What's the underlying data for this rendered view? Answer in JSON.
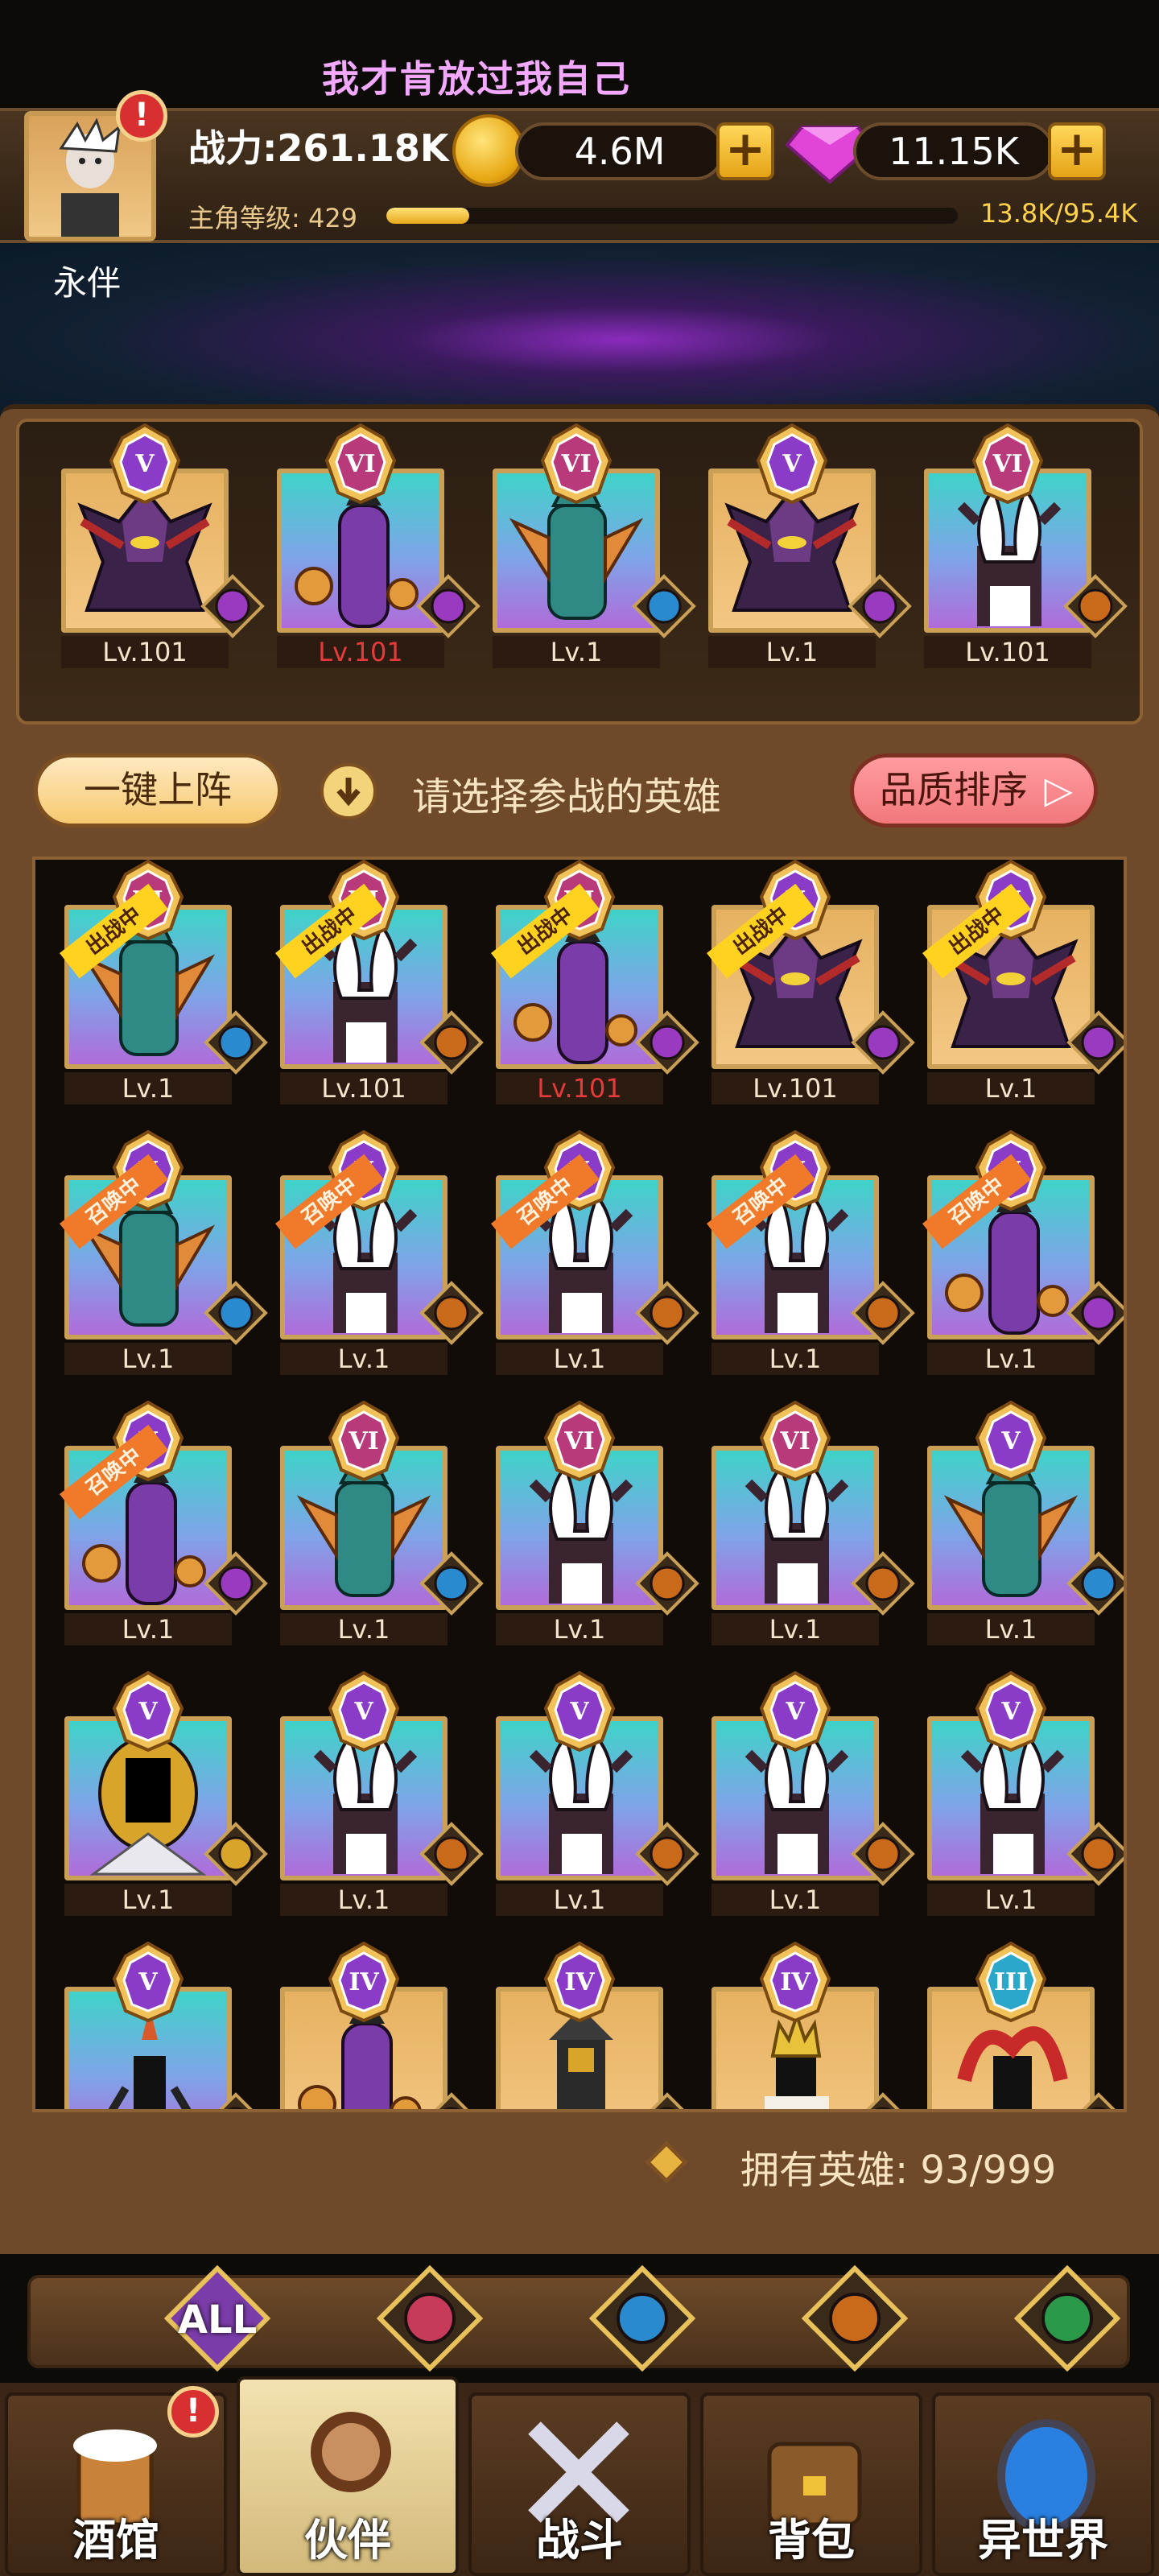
{
  "header": {
    "title": "我才肯放过我自己",
    "power": "战力:261.18K",
    "gold": "4.6M",
    "gems": "11.15K",
    "level_label": "主角等级: 429",
    "xp_text": "13.8K/95.4K",
    "xp_fraction": 0.145,
    "partner_name": "永伴"
  },
  "lineup": [
    {
      "tier": "V",
      "bg": "gold",
      "hero": "demon",
      "faction": "demon",
      "level": "Lv.101",
      "red": false
    },
    {
      "tier": "VI",
      "bg": "teal",
      "hero": "purple",
      "faction": "demon",
      "level": "Lv.101",
      "red": true
    },
    {
      "tier": "VI",
      "bg": "teal",
      "hero": "fish",
      "faction": "water",
      "level": "Lv.1",
      "red": false
    },
    {
      "tier": "V",
      "bg": "gold",
      "hero": "demon",
      "faction": "demon",
      "level": "Lv.1",
      "red": false
    },
    {
      "tier": "VI",
      "bg": "teal",
      "hero": "beast",
      "faction": "beast",
      "level": "Lv.101",
      "red": false
    }
  ],
  "controls": {
    "one_key": "一键上阵",
    "hint": "请选择参战的英雄",
    "sort": "品质排序"
  },
  "roster": [
    {
      "tier": "VI",
      "bg": "teal",
      "hero": "fish",
      "faction": "water",
      "level": "Lv.1",
      "tag": "出战中",
      "tagcolor": "y"
    },
    {
      "tier": "VI",
      "bg": "teal",
      "hero": "beast",
      "faction": "beast",
      "level": "Lv.101",
      "tag": "出战中",
      "tagcolor": "y"
    },
    {
      "tier": "VI",
      "bg": "teal",
      "hero": "purple",
      "faction": "demon",
      "level": "Lv.101",
      "tag": "出战中",
      "tagcolor": "y",
      "red": true
    },
    {
      "tier": "V",
      "bg": "gold",
      "hero": "demon",
      "faction": "demon",
      "level": "Lv.101",
      "tag": "出战中",
      "tagcolor": "y"
    },
    {
      "tier": "V",
      "bg": "gold",
      "hero": "demon",
      "faction": "demon",
      "level": "Lv.1",
      "tag": "出战中",
      "tagcolor": "y"
    },
    {
      "tier": "V",
      "bg": "teal",
      "hero": "fish",
      "faction": "water",
      "level": "Lv.1",
      "tag": "召唤中",
      "tagcolor": "o"
    },
    {
      "tier": "V",
      "bg": "teal",
      "hero": "beast",
      "faction": "beast",
      "level": "Lv.1",
      "tag": "召唤中",
      "tagcolor": "o"
    },
    {
      "tier": "V",
      "bg": "teal",
      "hero": "beast",
      "faction": "beast",
      "level": "Lv.1",
      "tag": "召唤中",
      "tagcolor": "o"
    },
    {
      "tier": "V",
      "bg": "teal",
      "hero": "beast",
      "faction": "beast",
      "level": "Lv.1",
      "tag": "召唤中",
      "tagcolor": "o"
    },
    {
      "tier": "V",
      "bg": "teal",
      "hero": "purple",
      "faction": "demon",
      "level": "Lv.1",
      "tag": "召唤中",
      "tagcolor": "o"
    },
    {
      "tier": "V",
      "bg": "teal",
      "hero": "purple",
      "faction": "demon",
      "level": "Lv.1",
      "tag": "召唤中",
      "tagcolor": "o"
    },
    {
      "tier": "VI",
      "bg": "teal",
      "hero": "fish",
      "faction": "water",
      "level": "Lv.1",
      "tag": "",
      "tagcolor": ""
    },
    {
      "tier": "VI",
      "bg": "teal",
      "hero": "beast",
      "faction": "beast",
      "level": "Lv.1",
      "tag": "",
      "tagcolor": ""
    },
    {
      "tier": "VI",
      "bg": "teal",
      "hero": "beast",
      "faction": "beast",
      "level": "Lv.1",
      "tag": "",
      "tagcolor": ""
    },
    {
      "tier": "V",
      "bg": "teal",
      "hero": "fish",
      "faction": "water",
      "level": "Lv.1",
      "tag": "",
      "tagcolor": ""
    },
    {
      "tier": "V",
      "bg": "teal",
      "hero": "holy",
      "faction": "holy",
      "level": "Lv.1",
      "tag": "",
      "tagcolor": ""
    },
    {
      "tier": "V",
      "bg": "teal",
      "hero": "beast",
      "faction": "beast",
      "level": "Lv.1",
      "tag": "",
      "tagcolor": ""
    },
    {
      "tier": "V",
      "bg": "teal",
      "hero": "beast",
      "faction": "beast",
      "level": "Lv.1",
      "tag": "",
      "tagcolor": ""
    },
    {
      "tier": "V",
      "bg": "teal",
      "hero": "beast",
      "faction": "beast",
      "level": "Lv.1",
      "tag": "",
      "tagcolor": ""
    },
    {
      "tier": "V",
      "bg": "teal",
      "hero": "beast",
      "faction": "beast",
      "level": "Lv.1",
      "tag": "",
      "tagcolor": ""
    },
    {
      "tier": "V",
      "bg": "teal",
      "hero": "dark",
      "faction": "demon",
      "level": "",
      "tag": "",
      "tagcolor": ""
    },
    {
      "tier": "IV",
      "bg": "gold",
      "hero": "purple",
      "faction": "demon",
      "level": "",
      "tag": "",
      "tagcolor": ""
    },
    {
      "tier": "IV",
      "bg": "gold",
      "hero": "pharaoh",
      "faction": "demon",
      "level": "",
      "tag": "",
      "tagcolor": ""
    },
    {
      "tier": "IV",
      "bg": "gold",
      "hero": "king",
      "faction": "demon",
      "level": "",
      "tag": "",
      "tagcolor": ""
    },
    {
      "tier": "III",
      "bg": "gold",
      "hero": "fire",
      "faction": "demon",
      "level": "",
      "tag": "",
      "tagcolor": ""
    }
  ],
  "owned": "拥有英雄: 93/999",
  "filters": [
    {
      "name": "all",
      "label": "ALL"
    },
    {
      "name": "holy",
      "label": ""
    },
    {
      "name": "water",
      "label": ""
    },
    {
      "name": "beast",
      "label": ""
    },
    {
      "name": "elf",
      "label": ""
    },
    {
      "name": "demon",
      "label": ""
    }
  ],
  "nav": [
    "酒馆",
    "伙伴",
    "战斗",
    "背包",
    "异世界"
  ],
  "colors": {
    "badge_v": "#8a3cc8",
    "badge_vi": "#b83a7a",
    "badge_iv": "#8a3cc8",
    "badge_iii": "#2aa7c9",
    "gold_frame": "#caa056"
  }
}
